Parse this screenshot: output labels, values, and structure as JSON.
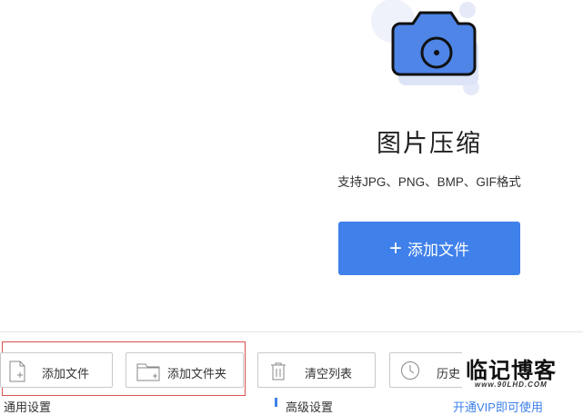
{
  "hero": {
    "title": "图片压缩",
    "subtitle": "支持JPG、PNG、BMP、GIF格式",
    "add_button_label": "添加文件",
    "add_button_icon": "plus-icon"
  },
  "toolbar": {
    "add_file_label": "添加文件",
    "add_folder_label": "添加文件夹",
    "clear_list_label": "清空列表",
    "history_label": "历史"
  },
  "watermark": {
    "main": "临记博客",
    "url": "www.90LHD.COM"
  },
  "bottom": {
    "left_label": "通用设置",
    "middle_label": "高级设置",
    "vip_link": "开通VIP即可使用"
  },
  "colors": {
    "accent": "#3f80ea",
    "highlight_border": "#d9534f",
    "camera_light": "#dde4f7"
  }
}
